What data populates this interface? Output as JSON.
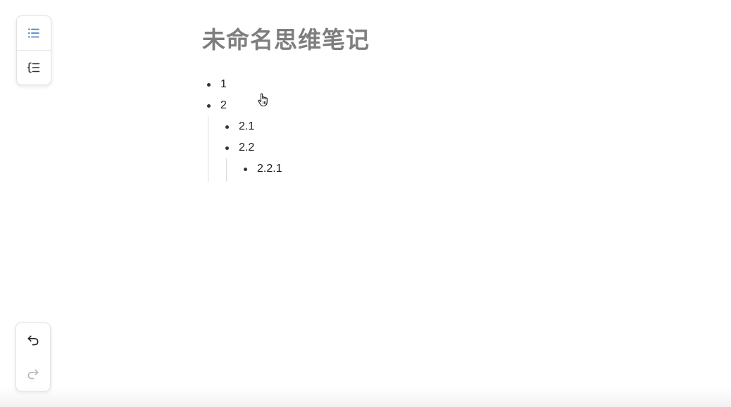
{
  "toolbar_top": {
    "outline_view_icon": "list-icon",
    "indent_icon": "indent-list-icon"
  },
  "toolbar_bottom": {
    "undo_icon": "undo-icon",
    "redo_icon": "redo-icon"
  },
  "document": {
    "title": "未命名思维笔记",
    "nodes": [
      {
        "text": "1"
      },
      {
        "text": "2",
        "children": [
          {
            "text": "2.1"
          },
          {
            "text": "2.2",
            "children": [
              {
                "text": "2.2.1"
              }
            ]
          }
        ]
      }
    ]
  },
  "colors": {
    "accent": "#2f6fbf",
    "title": "#7e7e7e",
    "disabled_icon": "#b8b8b8"
  }
}
